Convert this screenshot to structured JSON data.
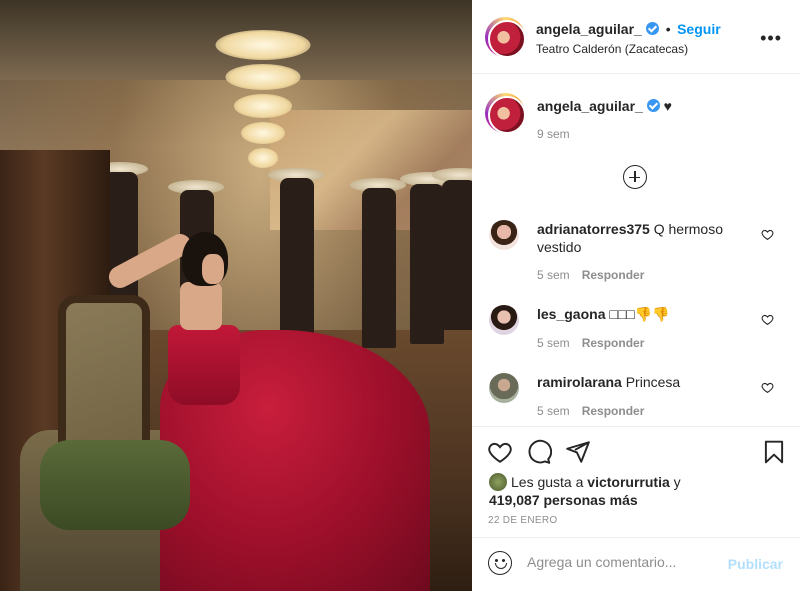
{
  "post": {
    "username": "angela_aguilar_",
    "follow_label": "Seguir",
    "separator": "•",
    "location": "Teatro Calderón (Zacatecas)",
    "more_label": "•••"
  },
  "caption": {
    "username": "angela_aguilar_",
    "text": "♥",
    "time": "9 sem"
  },
  "comments": [
    {
      "username": "adrianatorres375",
      "text": "Q hermoso vestido",
      "time": "5 sem",
      "reply_label": "Responder"
    },
    {
      "username": "les_gaona",
      "text": "□□□👎👎",
      "time": "5 sem",
      "reply_label": "Responder"
    },
    {
      "username": "ramirolarana",
      "text": "Princesa",
      "time": "5 sem",
      "reply_label": "Responder"
    }
  ],
  "likes": {
    "prefix": "Les gusta a",
    "first_user": "victorurrutia",
    "connector": "y",
    "others": "419,087 personas más"
  },
  "date": "22 DE ENERO",
  "comment_box": {
    "placeholder": "Agrega un comentario...",
    "publish_label": "Publicar"
  },
  "colors": {
    "link_blue": "#0095f6",
    "publish_disabled": "#b2dffc",
    "muted": "#8e8e8e",
    "text": "#262626"
  }
}
